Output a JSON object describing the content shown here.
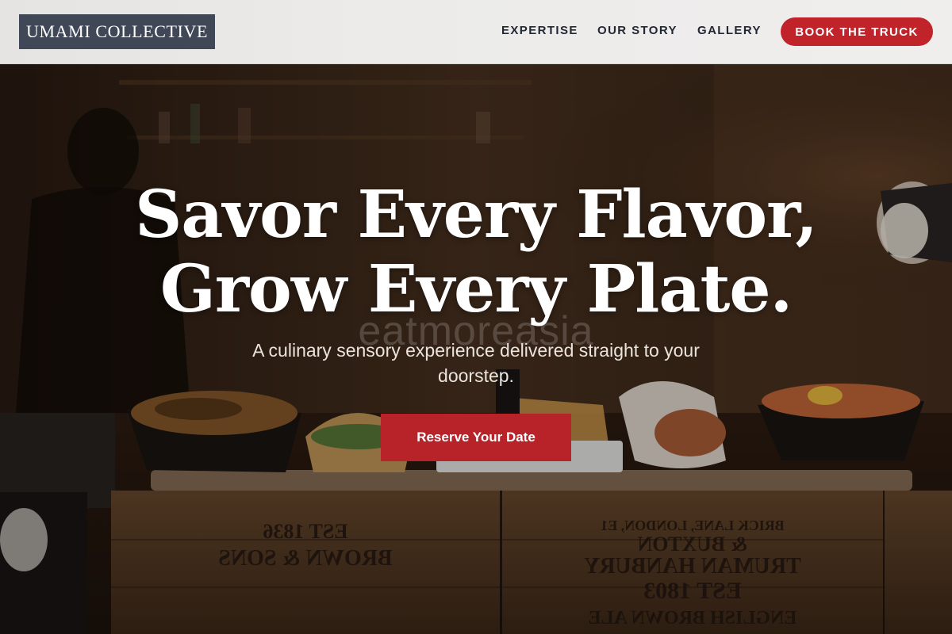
{
  "brand": {
    "logo_text": "UMAMI COLLECTIVE"
  },
  "nav": {
    "links": [
      {
        "label": "EXPERTISE"
      },
      {
        "label": "OUR STORY"
      },
      {
        "label": "GALLERY"
      }
    ],
    "cta_label": "BOOK THE TRUCK"
  },
  "hero": {
    "headline_line1": "Savor Every Flavor,",
    "headline_line2": "Grow Every Plate.",
    "subtitle": "A culinary sensory experience delivered straight to your doorstep.",
    "cta_label": "Reserve Your Date",
    "watermark_text": "eatmoreasia",
    "crate_text": {
      "left_top": "EST 1836",
      "left_mid": "BROWN & SONS",
      "right_top": "BRICK LANE, LONDON, E1",
      "right_mid": "& BUXTON",
      "right_brewery": "TRUMAN HANBURY",
      "right_year": "EST 1803",
      "right_bottom": "ENGLISH BROWN ALE"
    }
  },
  "colors": {
    "accent": "#c0232a",
    "logo_bg": "#404858",
    "nav_bg": "#ecebea",
    "nav_text": "#222833"
  },
  "icons": [
    "lamp-icon"
  ]
}
